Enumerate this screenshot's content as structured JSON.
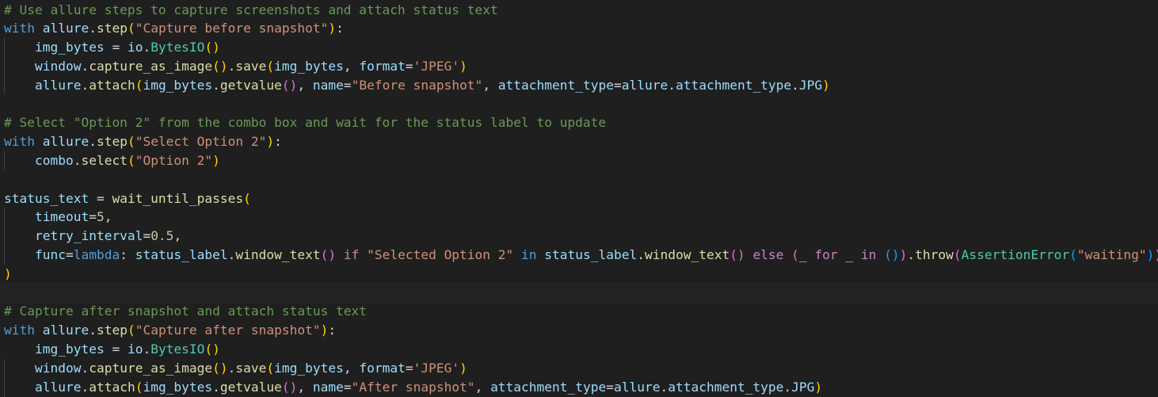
{
  "colors": {
    "background": "#1f1f1f",
    "comment": "#6a9955",
    "keyword": "#569cd6",
    "control": "#c586c0",
    "variable": "#9cdcfe",
    "function": "#dcdcaa",
    "string": "#ce9178",
    "plain": "#d4d4d4",
    "class": "#4ec9b0",
    "number": "#b5cea8",
    "bracket_level_1": "#ffd700",
    "bracket_level_2": "#da70d6",
    "bracket_level_3": "#179fff"
  },
  "editor": {
    "lines": [
      [
        [
          "c-comment",
          "# Use allure steps to capture screenshots and attach status text"
        ]
      ],
      [
        [
          "c-keyword",
          "with"
        ],
        [
          "c-plain",
          " "
        ],
        [
          "c-var",
          "allure"
        ],
        [
          "c-plain",
          "."
        ],
        [
          "c-func",
          "step"
        ],
        [
          "c-brace1",
          "("
        ],
        [
          "c-string",
          "\"Capture before snapshot\""
        ],
        [
          "c-brace1",
          ")"
        ],
        [
          "c-plain",
          ":"
        ]
      ],
      [
        [
          "c-plain",
          "    "
        ],
        [
          "c-var",
          "img_bytes"
        ],
        [
          "c-plain",
          " = "
        ],
        [
          "c-var",
          "io"
        ],
        [
          "c-plain",
          "."
        ],
        [
          "c-class",
          "BytesIO"
        ],
        [
          "c-brace1",
          "()"
        ]
      ],
      [
        [
          "c-plain",
          "    "
        ],
        [
          "c-var",
          "window"
        ],
        [
          "c-plain",
          "."
        ],
        [
          "c-func",
          "capture_as_image"
        ],
        [
          "c-brace1",
          "()"
        ],
        [
          "c-plain",
          "."
        ],
        [
          "c-func",
          "save"
        ],
        [
          "c-brace1",
          "("
        ],
        [
          "c-var",
          "img_bytes"
        ],
        [
          "c-plain",
          ", "
        ],
        [
          "c-var",
          "format"
        ],
        [
          "c-plain",
          "="
        ],
        [
          "c-string",
          "'JPEG'"
        ],
        [
          "c-brace1",
          ")"
        ]
      ],
      [
        [
          "c-plain",
          "    "
        ],
        [
          "c-var",
          "allure"
        ],
        [
          "c-plain",
          "."
        ],
        [
          "c-func",
          "attach"
        ],
        [
          "c-brace1",
          "("
        ],
        [
          "c-var",
          "img_bytes"
        ],
        [
          "c-plain",
          "."
        ],
        [
          "c-func",
          "getvalue"
        ],
        [
          "c-brace2",
          "()"
        ],
        [
          "c-plain",
          ", "
        ],
        [
          "c-var",
          "name"
        ],
        [
          "c-plain",
          "="
        ],
        [
          "c-string",
          "\"Before snapshot\""
        ],
        [
          "c-plain",
          ", "
        ],
        [
          "c-var",
          "attachment_type"
        ],
        [
          "c-plain",
          "="
        ],
        [
          "c-var",
          "allure"
        ],
        [
          "c-plain",
          "."
        ],
        [
          "c-var",
          "attachment_type"
        ],
        [
          "c-plain",
          "."
        ],
        [
          "c-var",
          "JPG"
        ],
        [
          "c-brace1",
          ")"
        ]
      ],
      [],
      [
        [
          "c-comment",
          "# Select \"Option 2\" from the combo box and wait for the status label to update"
        ]
      ],
      [
        [
          "c-keyword",
          "with"
        ],
        [
          "c-plain",
          " "
        ],
        [
          "c-var",
          "allure"
        ],
        [
          "c-plain",
          "."
        ],
        [
          "c-func",
          "step"
        ],
        [
          "c-brace1",
          "("
        ],
        [
          "c-string",
          "\"Select Option 2\""
        ],
        [
          "c-brace1",
          ")"
        ],
        [
          "c-plain",
          ":"
        ]
      ],
      [
        [
          "c-plain",
          "    "
        ],
        [
          "c-var",
          "combo"
        ],
        [
          "c-plain",
          "."
        ],
        [
          "c-func",
          "select"
        ],
        [
          "c-brace1",
          "("
        ],
        [
          "c-string",
          "\"Option 2\""
        ],
        [
          "c-brace1",
          ")"
        ]
      ],
      [],
      [
        [
          "c-var",
          "status_text"
        ],
        [
          "c-plain",
          " = "
        ],
        [
          "c-func",
          "wait_until_passes"
        ],
        [
          "c-brace1",
          "("
        ]
      ],
      [
        [
          "c-plain",
          "    "
        ],
        [
          "c-var",
          "timeout"
        ],
        [
          "c-plain",
          "="
        ],
        [
          "c-number",
          "5"
        ],
        [
          "c-plain",
          ","
        ]
      ],
      [
        [
          "c-plain",
          "    "
        ],
        [
          "c-var",
          "retry_interval"
        ],
        [
          "c-plain",
          "="
        ],
        [
          "c-number",
          "0.5"
        ],
        [
          "c-plain",
          ","
        ]
      ],
      [
        [
          "c-plain",
          "    "
        ],
        [
          "c-var",
          "func"
        ],
        [
          "c-plain",
          "="
        ],
        [
          "c-keyword",
          "lambda"
        ],
        [
          "c-plain",
          ": "
        ],
        [
          "c-var",
          "status_label"
        ],
        [
          "c-plain",
          "."
        ],
        [
          "c-func",
          "window_text"
        ],
        [
          "c-brace2",
          "()"
        ],
        [
          "c-plain",
          " "
        ],
        [
          "c-control",
          "if"
        ],
        [
          "c-plain",
          " "
        ],
        [
          "c-string",
          "\"Selected Option 2\""
        ],
        [
          "c-plain",
          " "
        ],
        [
          "c-keyword",
          "in"
        ],
        [
          "c-plain",
          " "
        ],
        [
          "c-var",
          "status_label"
        ],
        [
          "c-plain",
          "."
        ],
        [
          "c-func",
          "window_text"
        ],
        [
          "c-brace2",
          "()"
        ],
        [
          "c-plain",
          " "
        ],
        [
          "c-control",
          "else"
        ],
        [
          "c-plain",
          " "
        ],
        [
          "c-brace2",
          "("
        ],
        [
          "c-var",
          "_"
        ],
        [
          "c-plain",
          " "
        ],
        [
          "c-control",
          "for"
        ],
        [
          "c-plain",
          " "
        ],
        [
          "c-var",
          "_"
        ],
        [
          "c-plain",
          " "
        ],
        [
          "c-control",
          "in"
        ],
        [
          "c-plain",
          " "
        ],
        [
          "c-brace3",
          "()"
        ],
        [
          "c-brace2",
          ")"
        ],
        [
          "c-plain",
          "."
        ],
        [
          "c-func",
          "throw"
        ],
        [
          "c-brace2",
          "("
        ],
        [
          "c-class",
          "AssertionError"
        ],
        [
          "c-brace3",
          "("
        ],
        [
          "c-string",
          "\"waiting\""
        ],
        [
          "c-brace3",
          ")"
        ],
        [
          "c-brace2",
          ")"
        ],
        [
          "c-plain",
          ","
        ]
      ],
      [
        [
          "c-brace1",
          ")"
        ]
      ],
      [],
      [
        [
          "c-comment",
          "# Capture after snapshot and attach status text"
        ]
      ],
      [
        [
          "c-keyword",
          "with"
        ],
        [
          "c-plain",
          " "
        ],
        [
          "c-var",
          "allure"
        ],
        [
          "c-plain",
          "."
        ],
        [
          "c-func",
          "step"
        ],
        [
          "c-brace1",
          "("
        ],
        [
          "c-string",
          "\"Capture after snapshot\""
        ],
        [
          "c-brace1",
          ")"
        ],
        [
          "c-plain",
          ":"
        ]
      ],
      [
        [
          "c-plain",
          "    "
        ],
        [
          "c-var",
          "img_bytes"
        ],
        [
          "c-plain",
          " = "
        ],
        [
          "c-var",
          "io"
        ],
        [
          "c-plain",
          "."
        ],
        [
          "c-class",
          "BytesIO"
        ],
        [
          "c-brace1",
          "()"
        ]
      ],
      [
        [
          "c-plain",
          "    "
        ],
        [
          "c-var",
          "window"
        ],
        [
          "c-plain",
          "."
        ],
        [
          "c-func",
          "capture_as_image"
        ],
        [
          "c-brace1",
          "()"
        ],
        [
          "c-plain",
          "."
        ],
        [
          "c-func",
          "save"
        ],
        [
          "c-brace1",
          "("
        ],
        [
          "c-var",
          "img_bytes"
        ],
        [
          "c-plain",
          ", "
        ],
        [
          "c-var",
          "format"
        ],
        [
          "c-plain",
          "="
        ],
        [
          "c-string",
          "'JPEG'"
        ],
        [
          "c-brace1",
          ")"
        ]
      ],
      [
        [
          "c-plain",
          "    "
        ],
        [
          "c-var",
          "allure"
        ],
        [
          "c-plain",
          "."
        ],
        [
          "c-func",
          "attach"
        ],
        [
          "c-brace1",
          "("
        ],
        [
          "c-var",
          "img_bytes"
        ],
        [
          "c-plain",
          "."
        ],
        [
          "c-func",
          "getvalue"
        ],
        [
          "c-brace2",
          "()"
        ],
        [
          "c-plain",
          ", "
        ],
        [
          "c-var",
          "name"
        ],
        [
          "c-plain",
          "="
        ],
        [
          "c-string",
          "\"After snapshot\""
        ],
        [
          "c-plain",
          ", "
        ],
        [
          "c-var",
          "attachment_type"
        ],
        [
          "c-plain",
          "="
        ],
        [
          "c-var",
          "allure"
        ],
        [
          "c-plain",
          "."
        ],
        [
          "c-var",
          "attachment_type"
        ],
        [
          "c-plain",
          "."
        ],
        [
          "c-var",
          "JPG"
        ],
        [
          "c-brace1",
          ")"
        ]
      ]
    ]
  }
}
